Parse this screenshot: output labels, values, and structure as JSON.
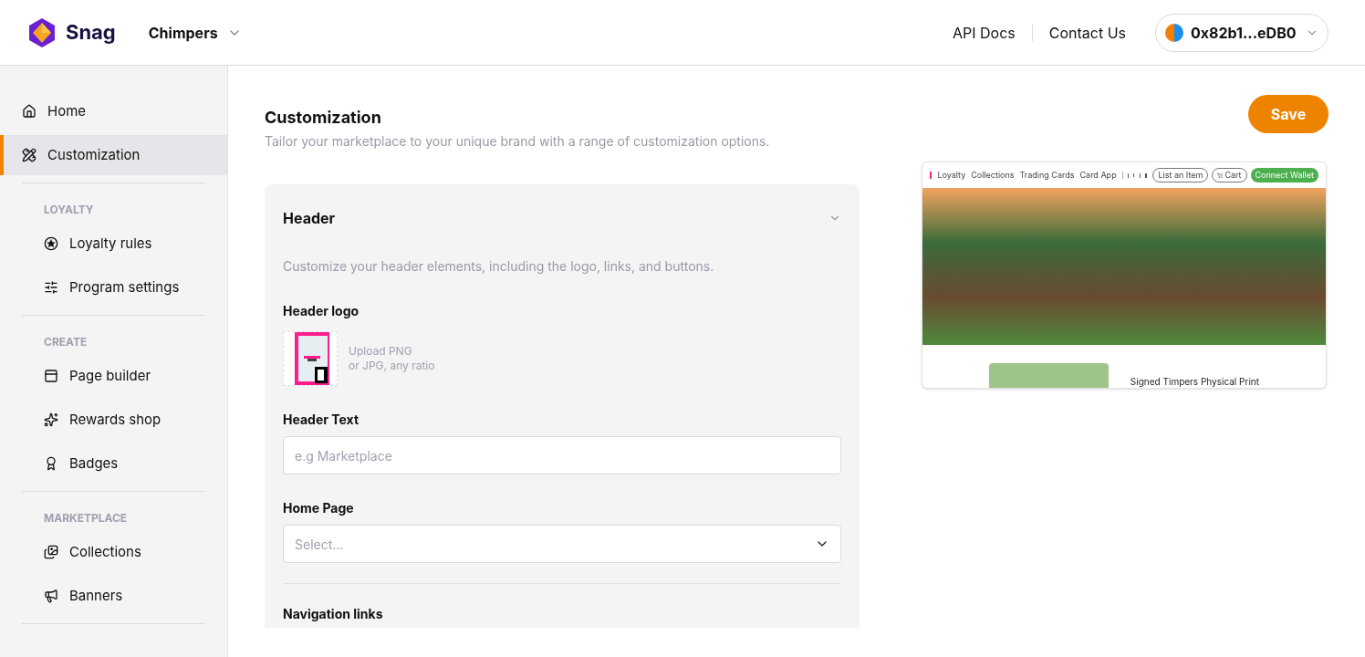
{
  "topbar": {
    "brand": "Snag",
    "project": "Chimpers",
    "links": [
      "API Docs",
      "Contact Us"
    ],
    "wallet": "0x82b1...eDB0"
  },
  "sidebar": {
    "sections": [
      {
        "items": [
          {
            "label": "Home",
            "selected": false
          },
          {
            "label": "Customization",
            "selected": true
          }
        ]
      },
      {
        "heading": "LOYALTY",
        "items": [
          {
            "label": "Loyalty rules",
            "selected": false
          },
          {
            "label": "Program settings",
            "selected": false
          }
        ]
      },
      {
        "heading": "CREATE",
        "items": [
          {
            "label": "Page builder",
            "selected": false
          },
          {
            "label": "Rewards shop",
            "selected": false
          },
          {
            "label": "Badges",
            "selected": false
          }
        ]
      },
      {
        "heading": "MARKETPLACE",
        "items": [
          {
            "label": "Collections",
            "selected": false
          },
          {
            "label": "Banners",
            "selected": false
          }
        ]
      }
    ]
  },
  "page": {
    "title": "Customization",
    "subtitle": "Tailor your marketplace to your unique brand with a range of customization options.",
    "save": "Save"
  },
  "panel": {
    "title": "Header",
    "expanded": true,
    "description": "Customize your header elements, including the logo, links, and buttons.",
    "logo_label": "Header logo",
    "logo_hint": [
      "Upload PNG",
      "or JPG, any ratio"
    ],
    "text_label": "Header Text",
    "text_placeholder": "e.g Marketplace",
    "home_label": "Home Page",
    "home_placeholder": "Select...",
    "nav_label": "Navigation links"
  },
  "preview": {
    "links": [
      "Loyalty",
      "Collections",
      "Trading Cards",
      "Card App"
    ],
    "buttons": [
      "List an Item",
      "Cart",
      "Connect Wallet"
    ],
    "item_title": "Signed Timpers Physical Print"
  }
}
